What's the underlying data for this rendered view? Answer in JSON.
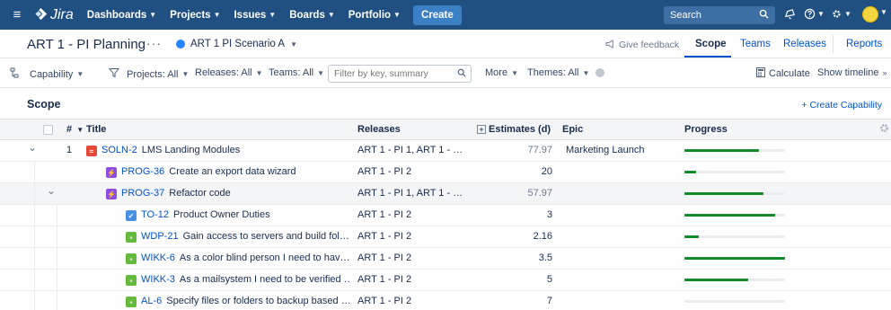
{
  "nav": {
    "hamburger": "≡",
    "logo": "Jira",
    "items": [
      {
        "label": "Dashboards"
      },
      {
        "label": "Projects"
      },
      {
        "label": "Issues"
      },
      {
        "label": "Boards"
      },
      {
        "label": "Portfolio"
      }
    ],
    "create": "Create",
    "search_placeholder": "Search",
    "brand_color": "#205081"
  },
  "titlebar": {
    "title": "ART 1 - PI Planning",
    "more": "···",
    "scenario": "ART 1 PI Scenario A",
    "feedback": "Give feedback",
    "tabs": [
      {
        "label": "Scope",
        "active": true
      },
      {
        "label": "Teams",
        "active": false
      },
      {
        "label": "Releases",
        "active": false
      },
      {
        "label": "Reports",
        "active": false
      }
    ]
  },
  "filters": {
    "hierarchy": "Capability",
    "projects": "Projects: All",
    "releases": "Releases: All",
    "teams": "Teams: All",
    "search_placeholder": "Filter by key, summary",
    "more": "More",
    "themes": "Themes: All",
    "calculate": "Calculate",
    "show_timeline": "Show timeline"
  },
  "scope": {
    "title": "Scope",
    "create_capability": "+ Create Capability"
  },
  "table": {
    "headers": {
      "rank": "#",
      "title": "Title",
      "releases": "Releases",
      "estimates": "Estimates (d)",
      "epic": "Epic",
      "progress": "Progress"
    },
    "rows": [
      {
        "rank": "1",
        "type": "capability",
        "key": "SOLN-2",
        "summary": "LMS Landing Modules",
        "releases": "ART 1 - PI 1, ART 1 - …",
        "estimate": "77.97",
        "estimate_muted": true,
        "epic": "Marketing Launch",
        "progress": 0.74,
        "expanded": true,
        "highlight": false
      },
      {
        "rank": "",
        "type": "epic",
        "key": "PROG-36",
        "summary": "Create an export data wizard",
        "releases": "ART 1 - PI 2",
        "estimate": "20",
        "estimate_muted": false,
        "epic": "",
        "progress": 0.12,
        "expanded": false,
        "highlight": false
      },
      {
        "rank": "",
        "type": "epic",
        "key": "PROG-37",
        "summary": "Refactor code",
        "releases": "ART 1 - PI 1, ART 1 - …",
        "estimate": "57.97",
        "estimate_muted": true,
        "epic": "",
        "progress": 0.79,
        "expanded": true,
        "highlight": true
      },
      {
        "rank": "",
        "type": "task",
        "key": "TO-12",
        "summary": "Product Owner Duties",
        "releases": "ART 1 - PI 2",
        "estimate": "3",
        "estimate_muted": false,
        "epic": "",
        "progress": 0.9,
        "expanded": false,
        "highlight": false
      },
      {
        "rank": "",
        "type": "story",
        "key": "WDP-21",
        "summary": "Gain access to servers and build fol…",
        "releases": "ART 1 - PI 2",
        "estimate": "2.16",
        "estimate_muted": false,
        "epic": "",
        "progress": 0.14,
        "expanded": false,
        "highlight": false
      },
      {
        "rank": "",
        "type": "story",
        "key": "WIKK-6",
        "summary": "As a color blind person I need to hav…",
        "releases": "ART 1 - PI 2",
        "estimate": "3.5",
        "estimate_muted": false,
        "epic": "",
        "progress": 1.0,
        "expanded": false,
        "highlight": false
      },
      {
        "rank": "",
        "type": "story",
        "key": "WIKK-3",
        "summary": "As a mailsystem I need to be verified …",
        "releases": "ART 1 - PI 2",
        "estimate": "5",
        "estimate_muted": false,
        "epic": "",
        "progress": 0.63,
        "expanded": false,
        "highlight": false
      },
      {
        "rank": "",
        "type": "story",
        "key": "AL-6",
        "summary": "Specify files or folders to backup based …",
        "releases": "ART 1 - PI 2",
        "estimate": "7",
        "estimate_muted": false,
        "epic": "",
        "progress": 0.0,
        "expanded": false,
        "highlight": false
      }
    ]
  },
  "type_colors": {
    "capability": "#e5493a",
    "epic": "#904ee2",
    "task": "#4a90e2",
    "story": "#63ba3c"
  },
  "progress_color": "#14892c"
}
